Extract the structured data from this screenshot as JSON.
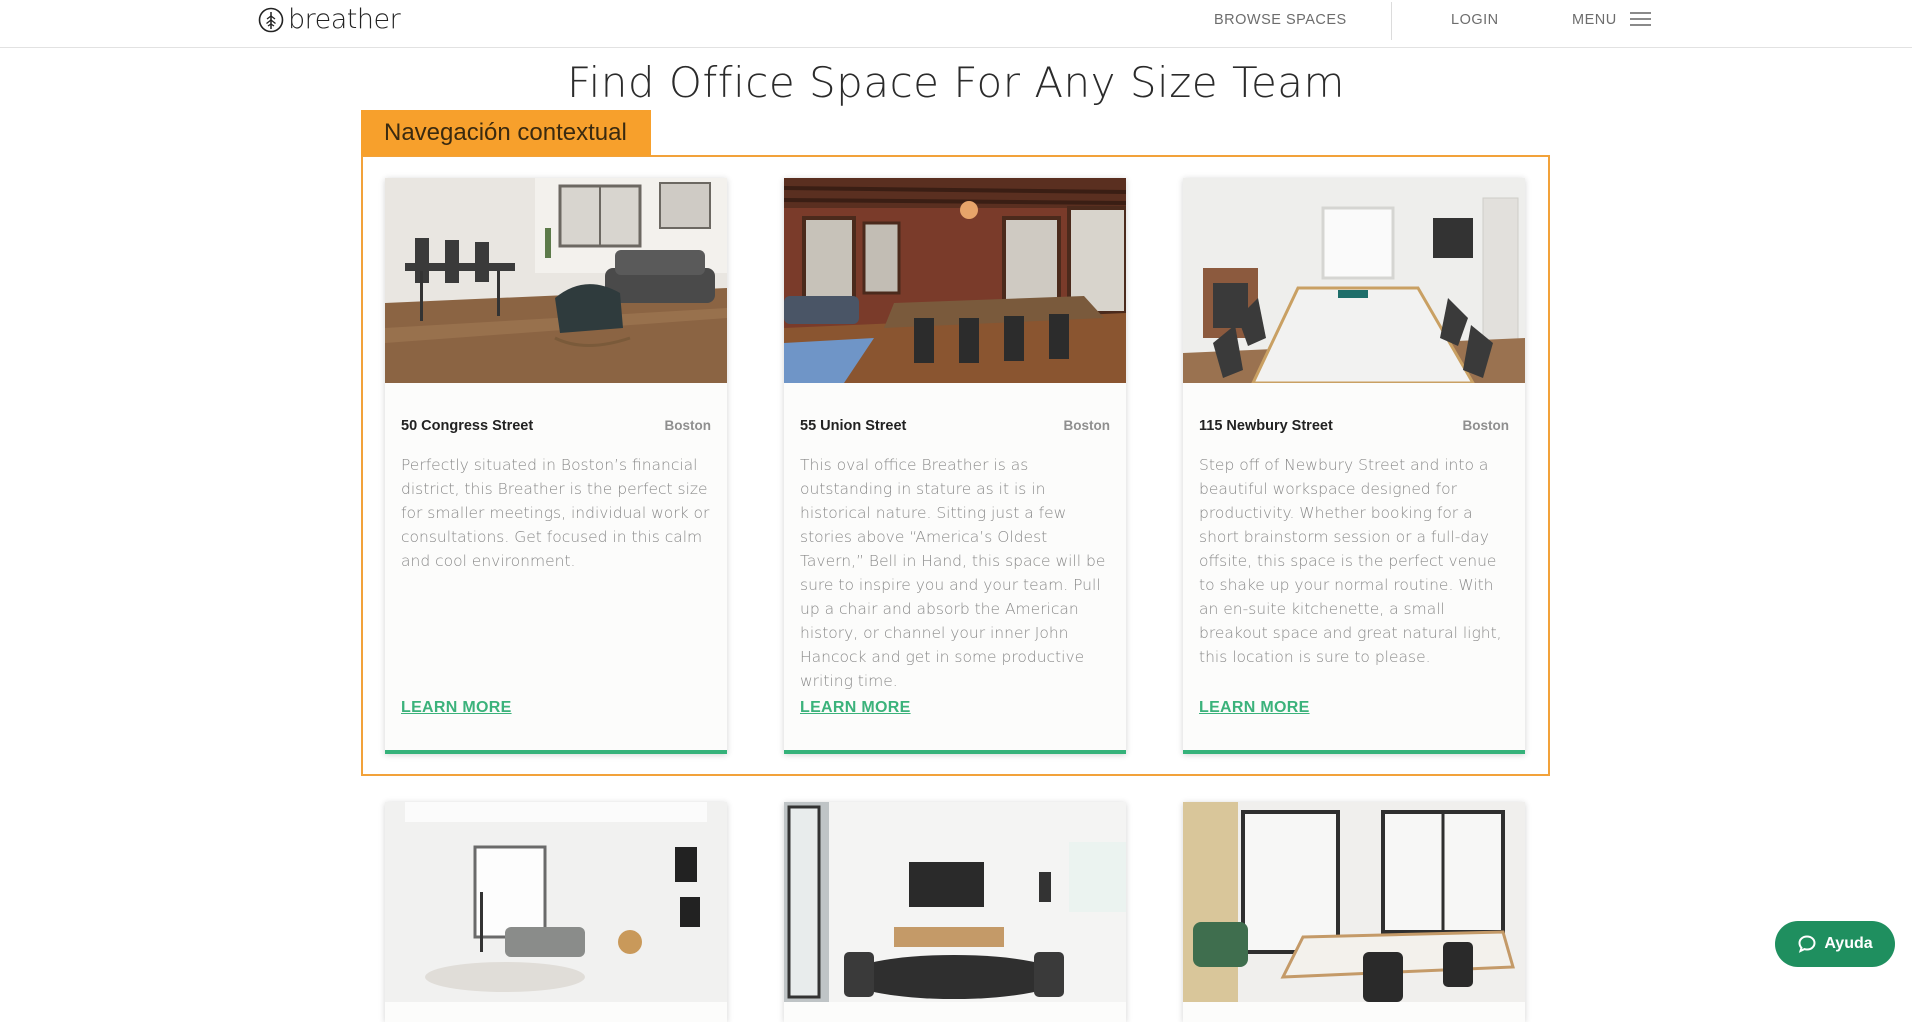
{
  "header": {
    "logo_text": "breather",
    "browse_label": "BROWSE SPACES",
    "login_label": "LOGIN",
    "menu_label": "MENU"
  },
  "page_title": "Find Office Space For Any Size Team",
  "context_tag": "Navegación contextual",
  "cards": [
    {
      "name": "50 Congress Street",
      "city": "Boston",
      "description": "Perfectly situated in Boston’s financial district, this Breather is the perfect size for smaller meetings, individual work or consultations. Get focused in this calm and cool environment.",
      "cta": "LEARN MORE"
    },
    {
      "name": "55 Union Street",
      "city": "Boston",
      "description": "This oval office Breather is as outstanding in stature as it is in historical nature. Sitting just a few stories above “America’s Oldest Tavern,” Bell in Hand, this space will be sure to inspire you and your team. Pull up a chair and absorb the American history, or channel your inner John Hancock and get in some productive writing time.",
      "cta": "LEARN MORE"
    },
    {
      "name": "115 Newbury Street",
      "city": "Boston",
      "description": "Step off of Newbury Street and into a beautiful workspace designed for productivity. Whether booking for a short brainstorm session or a full-day offsite, this space is the perfect venue to shake up your normal routine. With an en-suite kitchenette, a small breakout space and great natural light, this location is sure to please.",
      "cta": "LEARN MORE"
    }
  ],
  "help_button": {
    "label": "Ayuda",
    "icon": "chat-bubble-icon"
  },
  "colors": {
    "accent_green": "#35b27a",
    "help_green": "#1f8f5f",
    "context_orange": "#f7a02c"
  }
}
